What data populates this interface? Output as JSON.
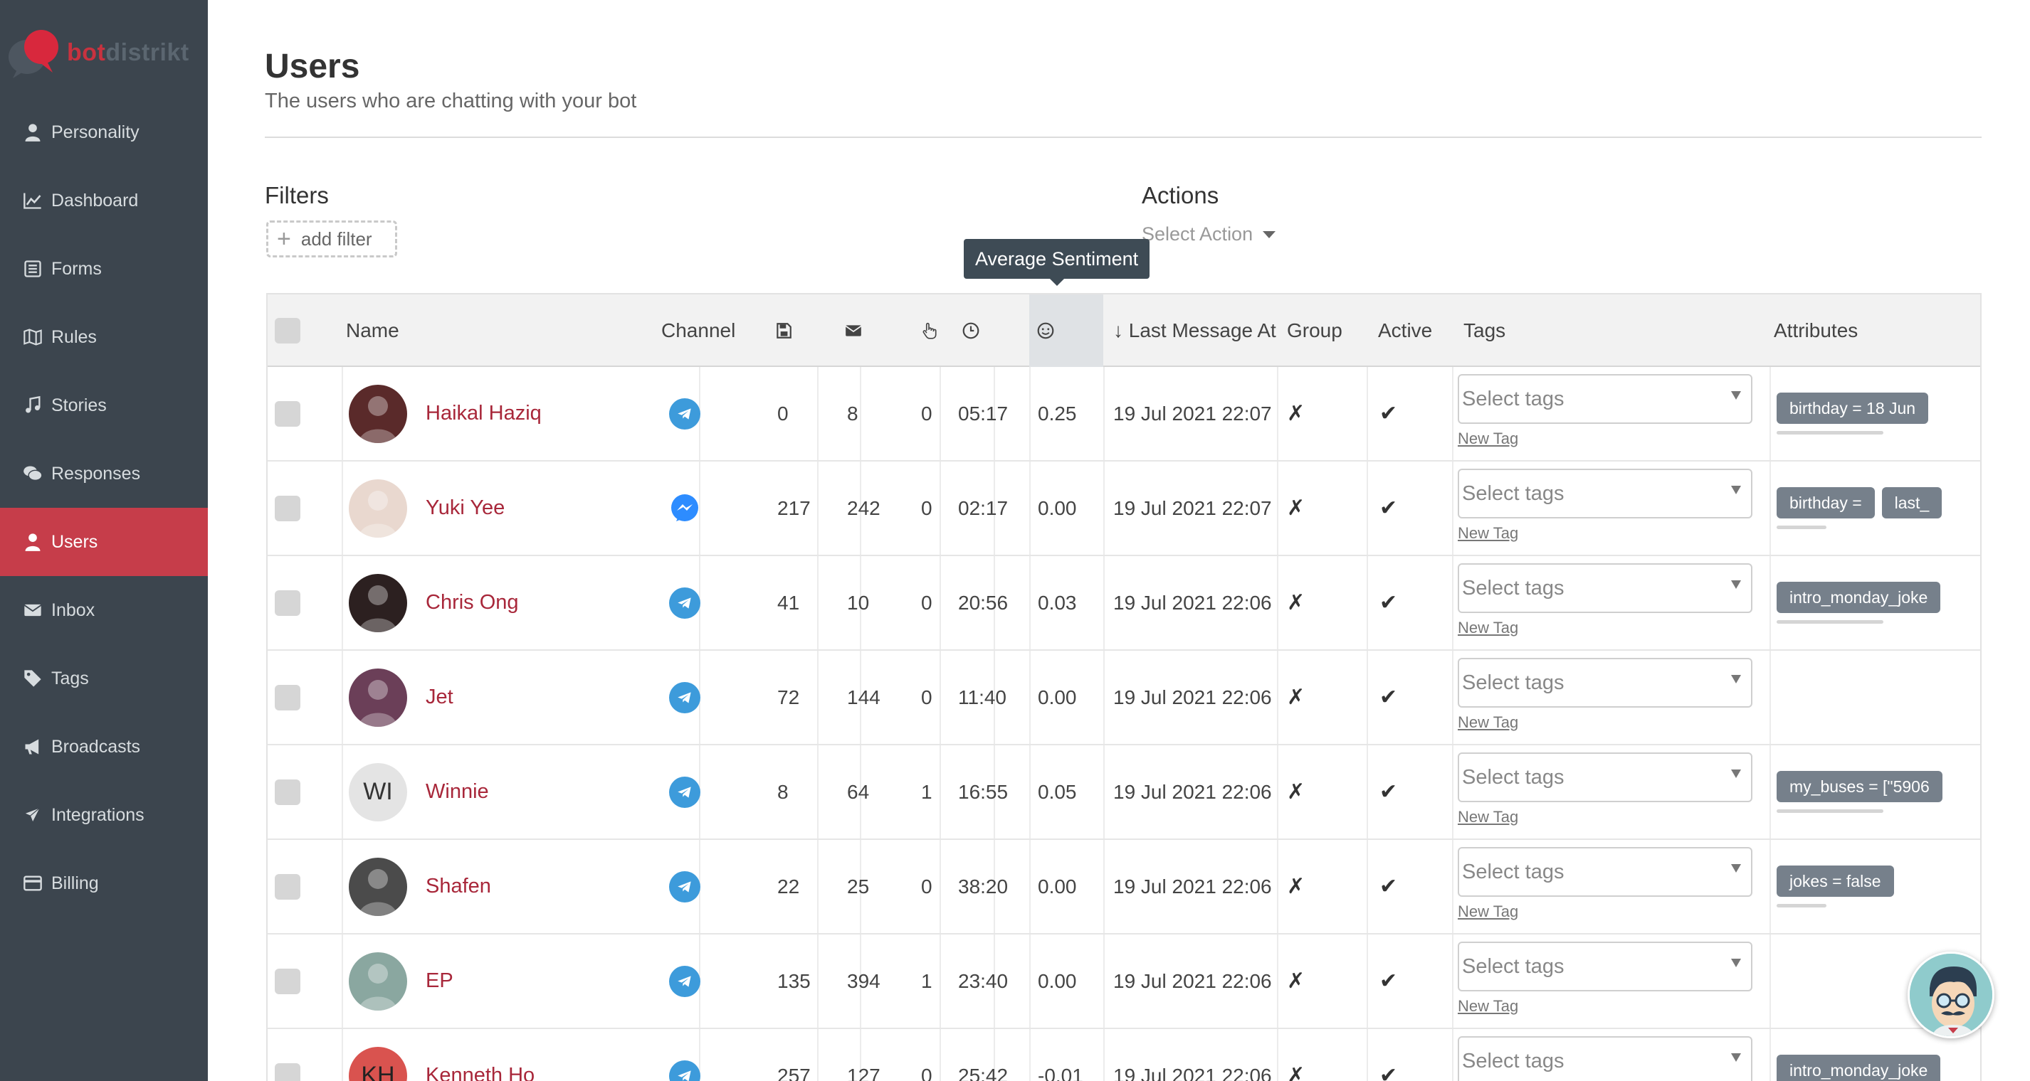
{
  "brand": {
    "name_part1": "bot",
    "name_part2": "distrikt"
  },
  "sidebar": {
    "items": [
      {
        "label": "Personality",
        "icon": "user-icon",
        "active": false
      },
      {
        "label": "Dashboard",
        "icon": "chart-line-icon",
        "active": false
      },
      {
        "label": "Forms",
        "icon": "list-icon",
        "active": false
      },
      {
        "label": "Rules",
        "icon": "map-icon",
        "active": false
      },
      {
        "label": "Stories",
        "icon": "music-note-icon",
        "active": false
      },
      {
        "label": "Responses",
        "icon": "comments-icon",
        "active": false
      },
      {
        "label": "Users",
        "icon": "user-icon",
        "active": true
      },
      {
        "label": "Inbox",
        "icon": "envelope-icon",
        "active": false
      },
      {
        "label": "Tags",
        "icon": "tag-icon",
        "active": false
      },
      {
        "label": "Broadcasts",
        "icon": "bullhorn-icon",
        "active": false
      },
      {
        "label": "Integrations",
        "icon": "plane-icon",
        "active": false
      },
      {
        "label": "Billing",
        "icon": "credit-card-icon",
        "active": false
      }
    ]
  },
  "page": {
    "title": "Users",
    "subtitle": "The users who are chatting with your bot"
  },
  "filters": {
    "title": "Filters",
    "add_label": "add filter"
  },
  "actions": {
    "title": "Actions",
    "select_label": "Select Action"
  },
  "tooltip": {
    "text": "Average Sentiment"
  },
  "table": {
    "headers": {
      "name": "Name",
      "channel": "Channel",
      "saved_icon": "save-icon",
      "messages_icon": "envelope-icon",
      "clicks_icon": "hand-pointer-icon",
      "time_icon": "clock-icon",
      "sentiment_icon": "smile-icon",
      "last_message": "↓ Last Message At",
      "group": "Group",
      "active": "Active",
      "tags": "Tags",
      "attributes": "Attributes"
    },
    "tag_placeholder": "Select tags",
    "new_tag_label": "New Tag",
    "rows": [
      {
        "name": "Haikal Haziq",
        "channel": "telegram",
        "saved": "0",
        "messages": "8",
        "clicks": "0",
        "time": "05:17",
        "sentiment": "0.25",
        "last_message": "19 Jul 2021 22:07",
        "group": "✗",
        "active": "✔",
        "attributes": [
          "birthday = 18 Jun"
        ],
        "avatar": "photo"
      },
      {
        "name": "Yuki Yee",
        "channel": "messenger",
        "saved": "217",
        "messages": "242",
        "clicks": "0",
        "time": "02:17",
        "sentiment": "0.00",
        "last_message": "19 Jul 2021 22:07",
        "group": "✗",
        "active": "✔",
        "attributes": [
          "birthday =",
          "last_"
        ],
        "avatar": "photo"
      },
      {
        "name": "Chris Ong",
        "channel": "telegram",
        "saved": "41",
        "messages": "10",
        "clicks": "0",
        "time": "20:56",
        "sentiment": "0.03",
        "last_message": "19 Jul 2021 22:06",
        "group": "✗",
        "active": "✔",
        "attributes": [
          "intro_monday_joke"
        ],
        "avatar": "photo"
      },
      {
        "name": "Jet",
        "channel": "telegram",
        "saved": "72",
        "messages": "144",
        "clicks": "0",
        "time": "11:40",
        "sentiment": "0.00",
        "last_message": "19 Jul 2021 22:06",
        "group": "✗",
        "active": "✔",
        "attributes": [],
        "avatar": "photo"
      },
      {
        "name": "Winnie",
        "channel": "telegram",
        "saved": "8",
        "messages": "64",
        "clicks": "1",
        "time": "16:55",
        "sentiment": "0.05",
        "last_message": "19 Jul 2021 22:06",
        "group": "✗",
        "active": "✔",
        "attributes": [
          "my_buses = [\"5906"
        ],
        "avatar": "WI"
      },
      {
        "name": "Shafen",
        "channel": "telegram",
        "saved": "22",
        "messages": "25",
        "clicks": "0",
        "time": "38:20",
        "sentiment": "0.00",
        "last_message": "19 Jul 2021 22:06",
        "group": "✗",
        "active": "✔",
        "attributes": [
          "jokes = false"
        ],
        "avatar": "photo"
      },
      {
        "name": "EP",
        "channel": "telegram",
        "saved": "135",
        "messages": "394",
        "clicks": "1",
        "time": "23:40",
        "sentiment": "0.00",
        "last_message": "19 Jul 2021 22:06",
        "group": "✗",
        "active": "✔",
        "attributes": [],
        "avatar": "photo"
      },
      {
        "name": "Kenneth Ho",
        "channel": "telegram",
        "saved": "257",
        "messages": "127",
        "clicks": "0",
        "time": "25:42",
        "sentiment": "-0.01",
        "last_message": "19 Jul 2021 22:06",
        "group": "✗",
        "active": "✔",
        "attributes": [
          "intro_monday_joke"
        ],
        "avatar": "KH"
      }
    ]
  },
  "colors": {
    "sidebar_bg": "#3c454e",
    "accent": "#c63d4a",
    "link": "#a8273a",
    "telegram": "#3d9bdb",
    "chip": "#76808b"
  }
}
